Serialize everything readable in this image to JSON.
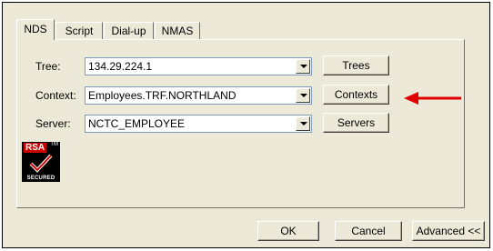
{
  "tabs": [
    {
      "label": "NDS",
      "active": true
    },
    {
      "label": "Script",
      "active": false
    },
    {
      "label": "Dial-up",
      "active": false
    },
    {
      "label": "NMAS",
      "active": false
    }
  ],
  "fields": {
    "tree": {
      "label": "Tree:",
      "value": "134.29.224.1",
      "button": "Trees"
    },
    "context": {
      "label": "Context:",
      "value": "Employees.TRF.NORTHLAND",
      "button": "Contexts"
    },
    "server": {
      "label": "Server:",
      "value": "NCTC_EMPLOYEE",
      "button": "Servers"
    }
  },
  "logo": {
    "text": "RSA",
    "tm": "TM",
    "subtext": "SECURED"
  },
  "footer": {
    "ok": "OK",
    "cancel": "Cancel",
    "advanced": "Advanced <<"
  },
  "colors": {
    "arrow": "#e00000",
    "dialog_bg": "#ece9d8",
    "rsa_red": "#cc0000"
  }
}
